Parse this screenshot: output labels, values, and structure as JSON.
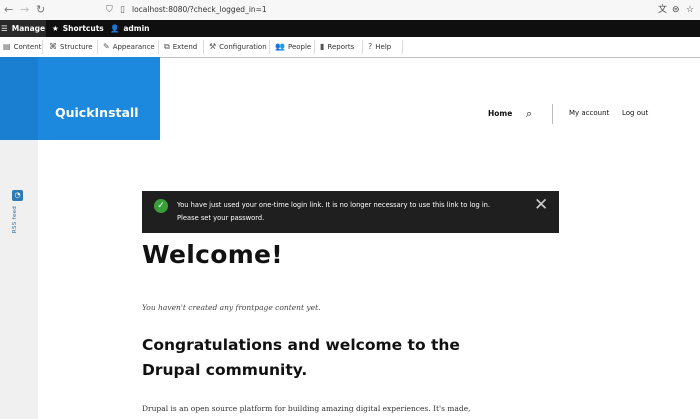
{
  "browser": {
    "url": "localhost:8080/?check_logged_in=1",
    "back": "←",
    "forward": "→",
    "reload": "↻"
  },
  "toolbar": {
    "manage": "Manage",
    "shortcuts": "Shortcuts",
    "user": "admin"
  },
  "admin_menu": {
    "items": [
      "Content",
      "Structure",
      "Appearance",
      "Extend",
      "Configuration",
      "People",
      "Reports",
      "Help"
    ]
  },
  "site": {
    "name": "QuickInstall",
    "brand_color": "#1c89de"
  },
  "main_nav": {
    "home": "Home",
    "my_account": "My account",
    "log_out": "Log out"
  },
  "message": {
    "line1": "You have just used your one-time login link. It is no longer necessary to use this link to log in.",
    "line2": "Please set your password.",
    "status_color": "#3a9e3a"
  },
  "page": {
    "title": "Welcome!",
    "no_content": "You haven't created any frontpage content yet.",
    "congrats": "Congratulations and welcome to the Drupal community.",
    "body": "Drupal is an open source platform for building amazing digital experiences. It's made,"
  },
  "sidebar": {
    "rss_label": "RSS feed"
  }
}
